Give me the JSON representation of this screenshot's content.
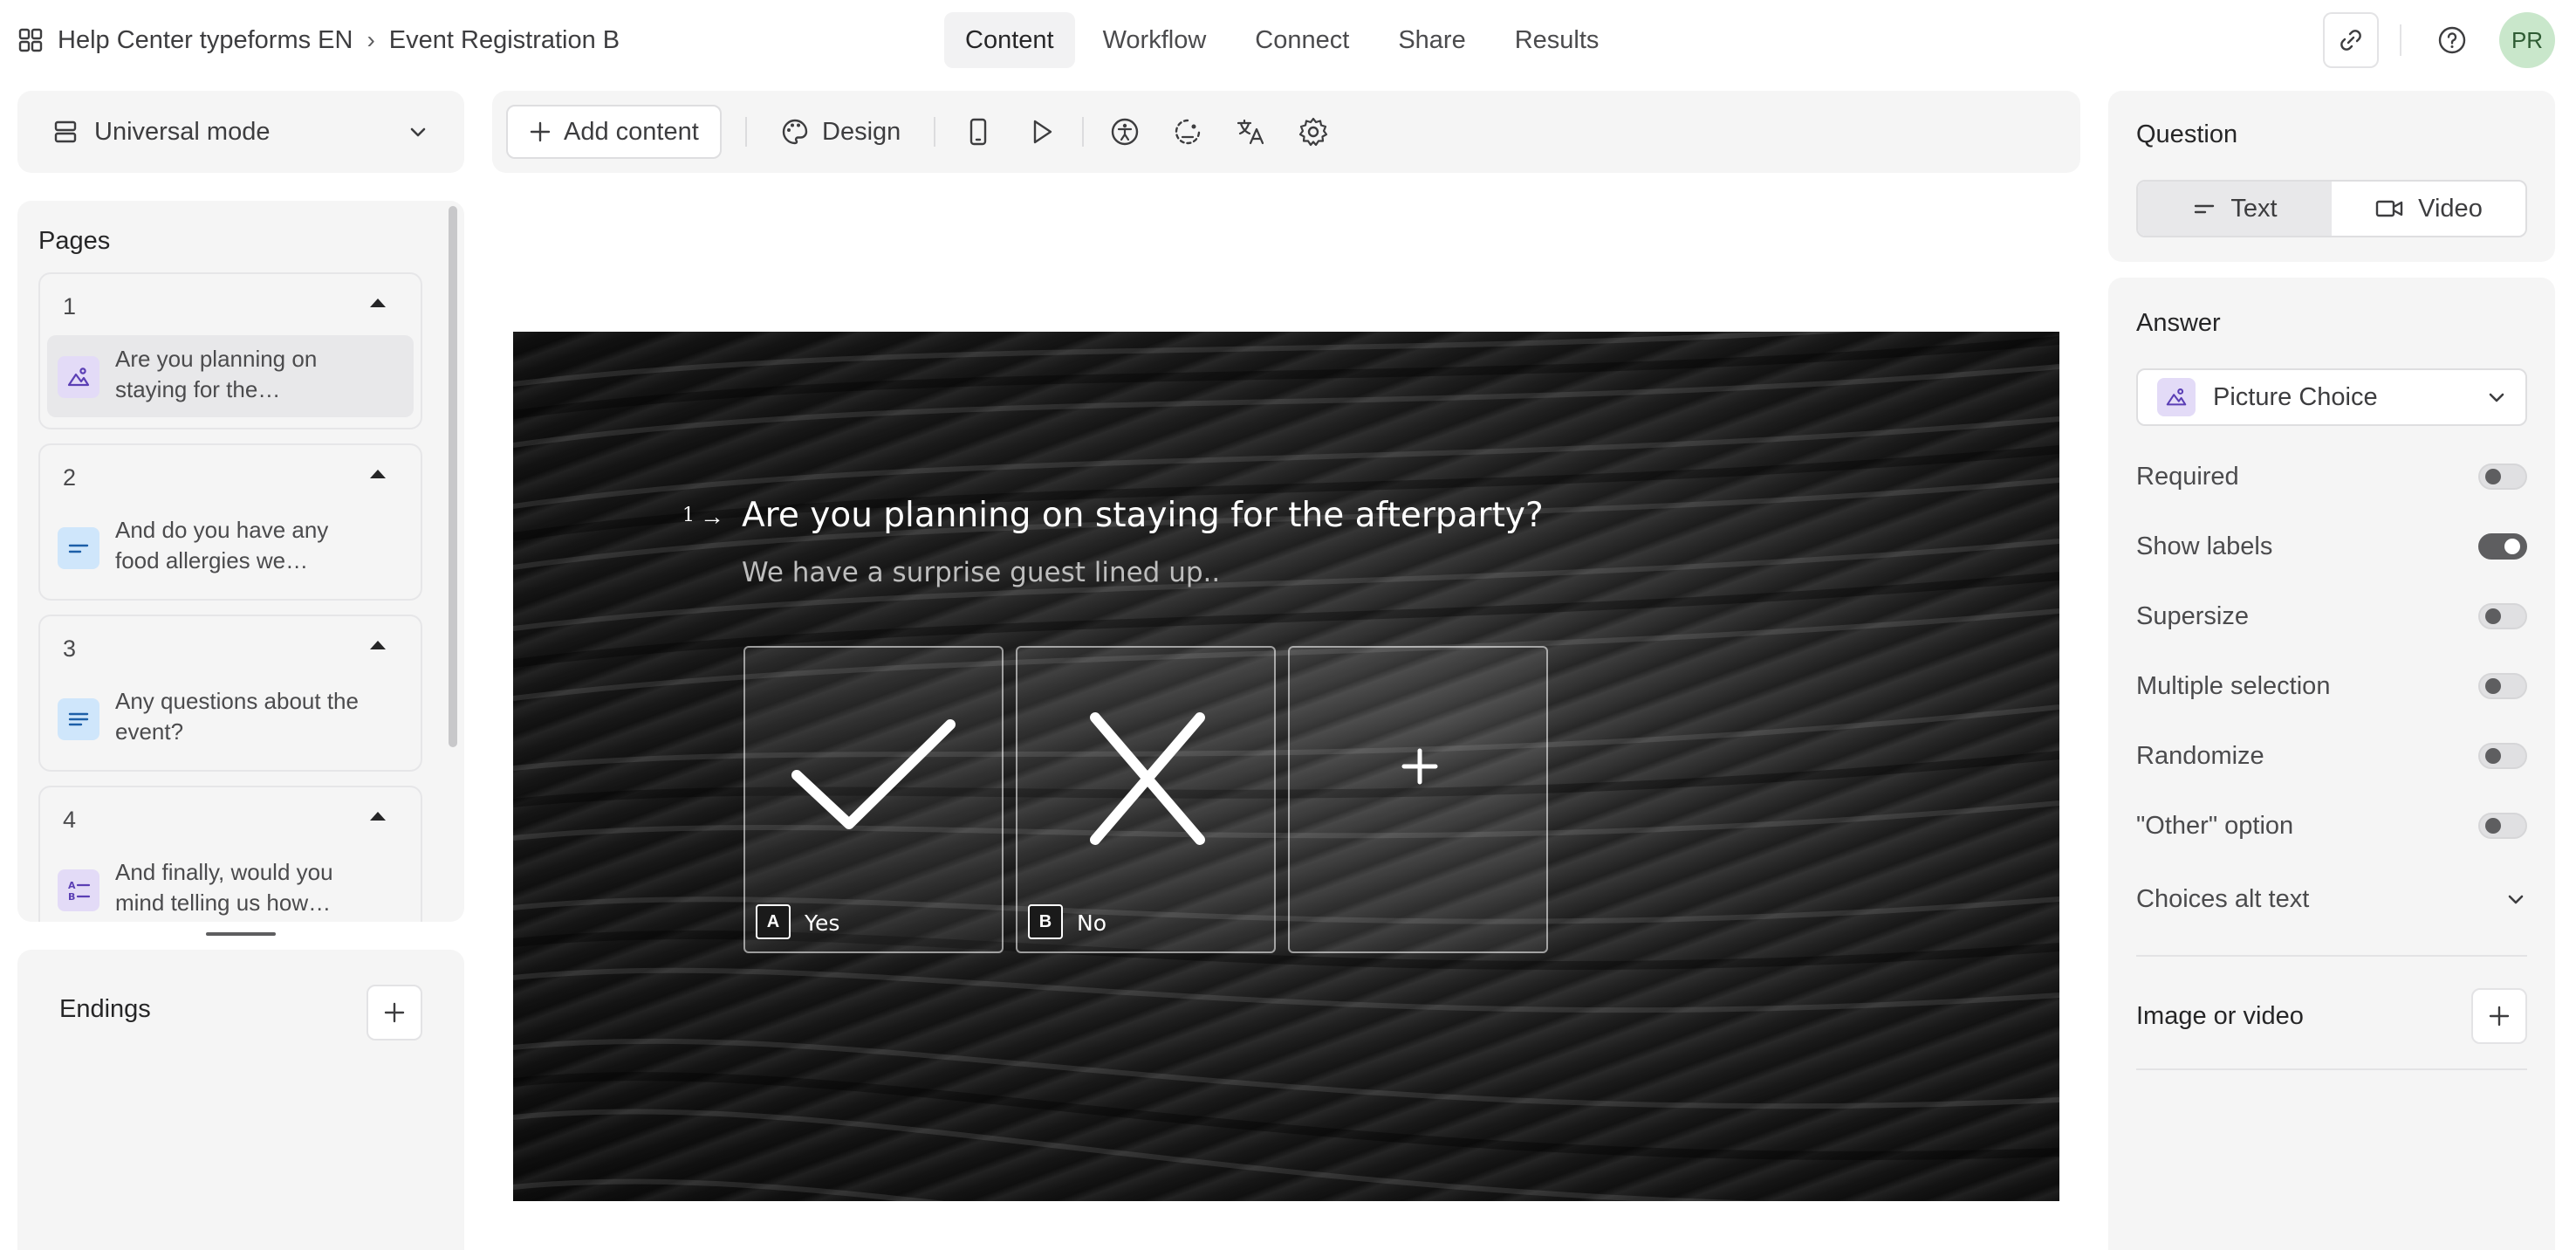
{
  "breadcrumb": {
    "workspace": "Help Center typeforms EN",
    "separator": "›",
    "form": "Event Registration B"
  },
  "nav": {
    "tabs": [
      "Content",
      "Workflow",
      "Connect",
      "Share",
      "Results"
    ],
    "active": "Content"
  },
  "user": {
    "initials": "PR"
  },
  "mode": {
    "label": "Universal mode"
  },
  "pages": {
    "title": "Pages",
    "items": [
      {
        "number": "1",
        "text": "Are you planning on staying for the…",
        "icon": "picture-choice-icon"
      },
      {
        "number": "2",
        "text": "And do you have any food allergies we…",
        "icon": "short-text-icon"
      },
      {
        "number": "3",
        "text": "Any questions about the event?",
        "icon": "long-text-icon"
      },
      {
        "number": "4",
        "text": "And finally, would you mind telling us how…",
        "icon": "multiple-choice-icon"
      }
    ]
  },
  "endings": {
    "title": "Endings"
  },
  "toolbar": {
    "add_label": "Add content",
    "design_label": "Design"
  },
  "question": {
    "number": "1",
    "title": "Are you planning on staying for the afterparty?",
    "subtitle": "We have a surprise guest lined up..",
    "choices": [
      {
        "key": "A",
        "label": "Yes"
      },
      {
        "key": "B",
        "label": "No"
      }
    ]
  },
  "right_panel": {
    "question_title": "Question",
    "question_types": [
      "Text",
      "Video"
    ],
    "answer_title": "Answer",
    "answer_type": "Picture Choice",
    "settings": [
      {
        "label": "Required",
        "on": false
      },
      {
        "label": "Show labels",
        "on": true
      },
      {
        "label": "Supersize",
        "on": false
      },
      {
        "label": "Multiple selection",
        "on": false
      },
      {
        "label": "Randomize",
        "on": false
      },
      {
        "label": "\"Other\" option",
        "on": false
      }
    ],
    "alt_text_label": "Choices alt text",
    "media_label": "Image or video"
  },
  "colors": {
    "accent_toggle": "#5e5e60",
    "picture_icon_bg": "#e3dbf7",
    "text_icon_bg": "#cfe6fb",
    "avatar_bg": "#c9e7cb"
  }
}
